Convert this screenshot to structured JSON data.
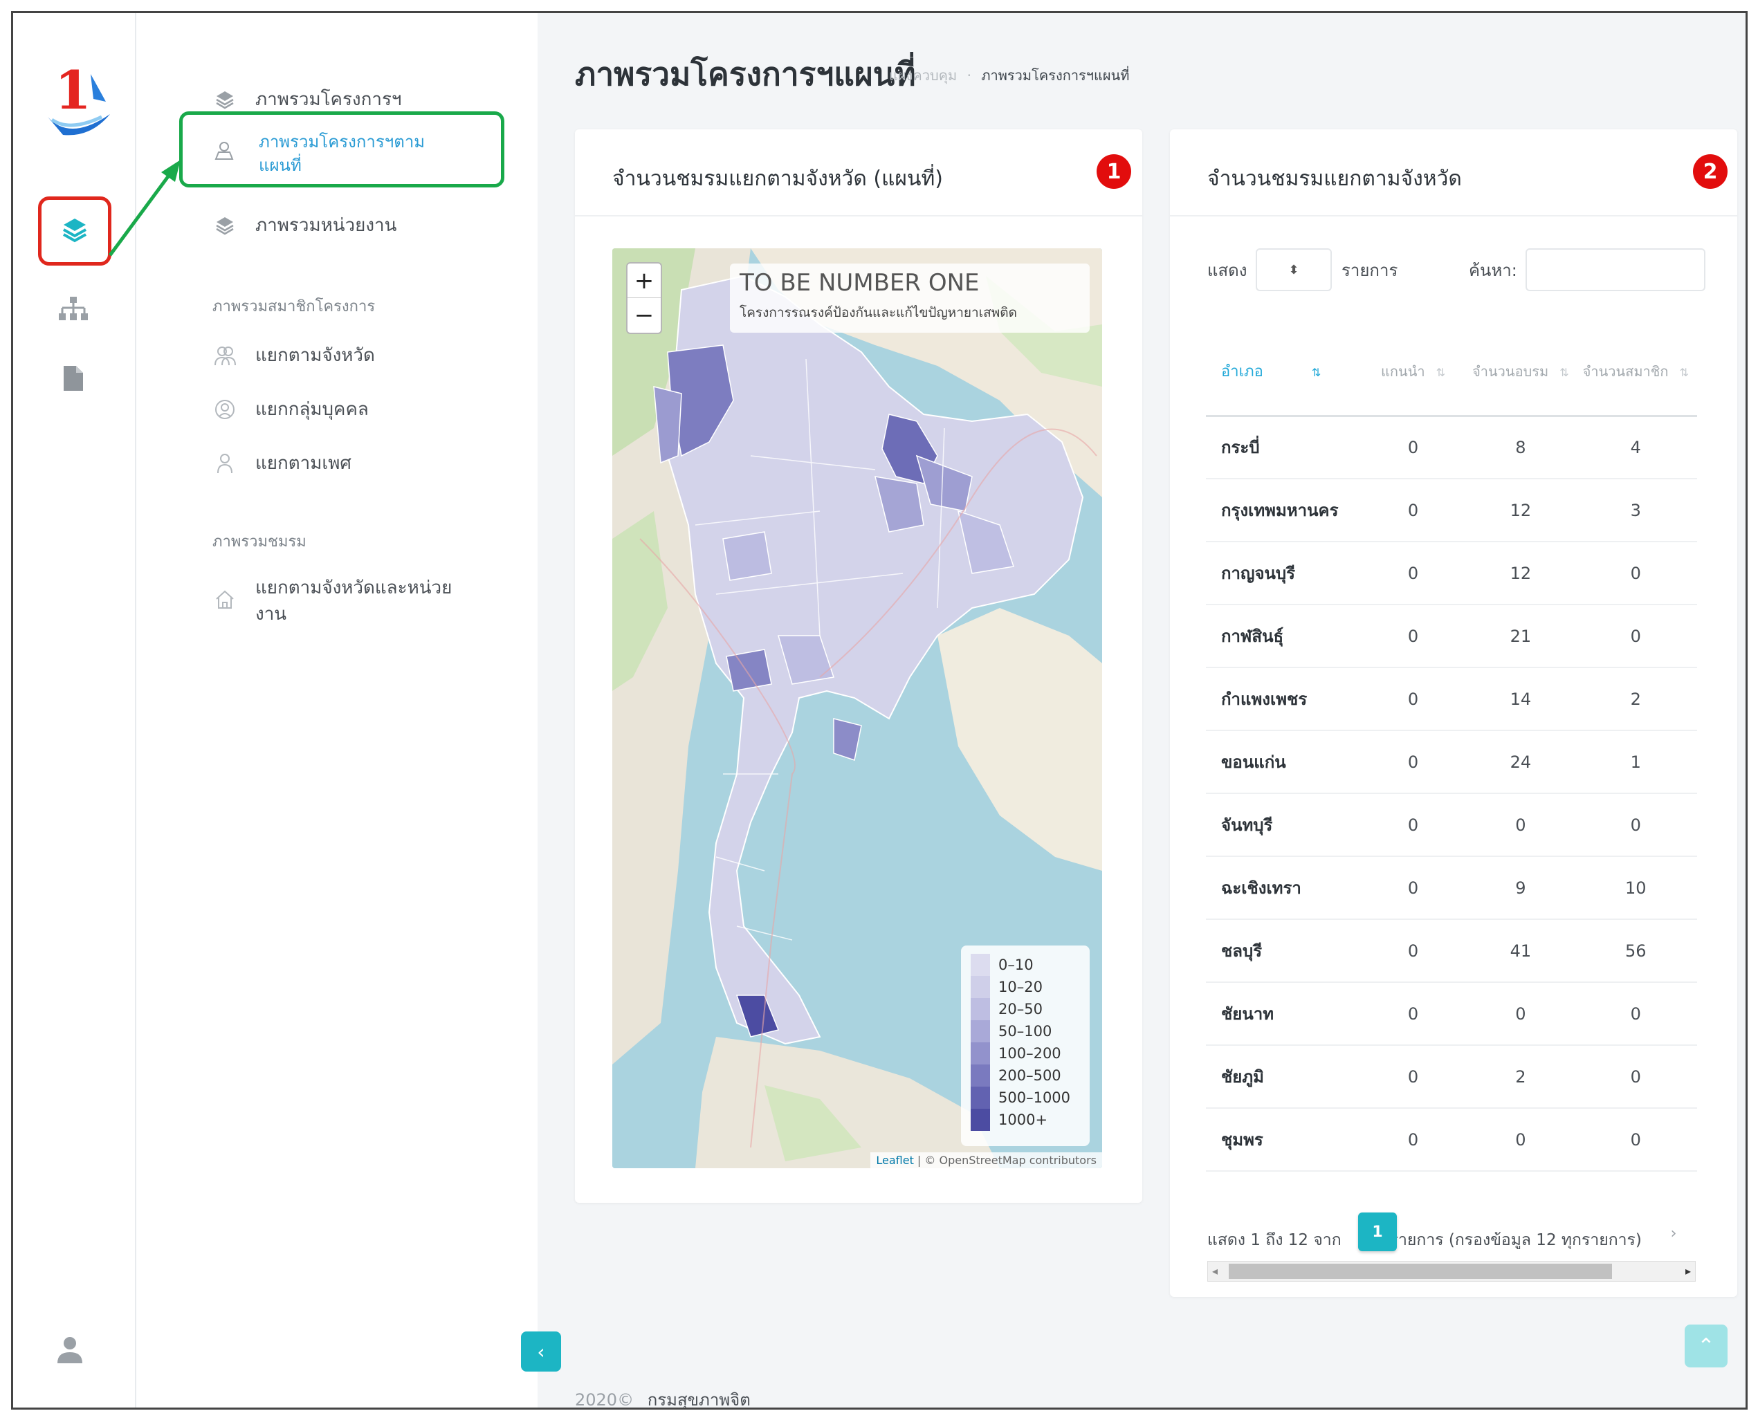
{
  "colors": {
    "accent": "#1cb5c4",
    "active_link": "#2a9bd4",
    "highlight_green": "#19a94a",
    "highlight_red": "#e0271d",
    "badge_red": "#e20d0d"
  },
  "rail": {
    "logo_digit": "1",
    "icons": [
      "layers-icon",
      "sitemap-icon",
      "document-icon",
      "user-icon"
    ]
  },
  "menu": {
    "items": [
      {
        "label": "ภาพรวมโครงการฯ",
        "icon": "layers-icon"
      },
      {
        "label": "ภาพรวมโครงการฯตามแผนที่",
        "icon": "map-user-icon"
      },
      {
        "label": "ภาพรวมหน่วยงาน",
        "icon": "layers-icon"
      }
    ],
    "members_section_title": "ภาพรวมสมาชิกโครงการ",
    "members_items": [
      {
        "label": "แยกตามจังหวัด",
        "icon": "users-icon"
      },
      {
        "label": "แยกกลุ่มบุคคล",
        "icon": "badge-icon"
      },
      {
        "label": "แยกตามเพศ",
        "icon": "person-icon"
      }
    ],
    "clubs_section_title": "ภาพรวมชมรม",
    "clubs_items": [
      {
        "label": "แยกตามจังหวัดและหน่วยงาน",
        "icon": "home-icon"
      }
    ]
  },
  "page": {
    "title": "ภาพรวมโครงการฯแผนที่",
    "breadcrumb_home": "แผงควบคุม",
    "breadcrumb_sep": "·",
    "breadcrumb_current": "ภาพรวมโครงการฯแผนที่"
  },
  "map_card": {
    "title": "จำนวนชมรมแยกตามจังหวัด (แผนที่)",
    "badge": "1",
    "zoom_in": "+",
    "zoom_out": "−",
    "info_title": "TO BE NUMBER ONE",
    "info_subtitle": "โครงการรณรงค์ป้องกันและแก้ไขปัญหายาเสพติด",
    "legend": [
      "0–10",
      "10–20",
      "20–50",
      "50–100",
      "100–200",
      "200–500",
      "500–1000",
      "1000+"
    ],
    "legend_colors": [
      "#dcdcef",
      "#cfcfe9",
      "#bebee2",
      "#a9a9d8",
      "#9292cc",
      "#7a7abf",
      "#6262b1",
      "#4c4ca2"
    ],
    "attribution_leaflet": "Leaflet",
    "attribution_rest": " | © OpenStreetMap contributors"
  },
  "table_card": {
    "title": "จำนวนชมรมแยกตามจังหวัด",
    "badge": "2",
    "show_label": "แสดง",
    "select_value": "",
    "select_arrow": "⬍",
    "rows_label": "รายการ",
    "search_label": "ค้นหา:",
    "columns": [
      "อำเภอ",
      "แกนนำ",
      "จำนวนอบรม",
      "จำนวนสมาชิก"
    ],
    "rows": [
      [
        "กระบี่",
        "0",
        "8",
        "4"
      ],
      [
        "กรุงเทพมหานคร",
        "0",
        "12",
        "3"
      ],
      [
        "กาญจนบุรี",
        "0",
        "12",
        "0"
      ],
      [
        "กาฬสินธุ์",
        "0",
        "21",
        "0"
      ],
      [
        "กำแพงเพชร",
        "0",
        "14",
        "2"
      ],
      [
        "ขอนแก่น",
        "0",
        "24",
        "1"
      ],
      [
        "จันทบุรี",
        "0",
        "0",
        "0"
      ],
      [
        "ฉะเชิงเทรา",
        "0",
        "9",
        "10"
      ],
      [
        "ชลบุรี",
        "0",
        "41",
        "56"
      ],
      [
        "ชัยนาท",
        "0",
        "0",
        "0"
      ],
      [
        "ชัยภูมิ",
        "0",
        "2",
        "0"
      ],
      [
        "ชุมพร",
        "0",
        "0",
        "0"
      ]
    ],
    "info_prefix": "แสดง 1 ถึง 12 จาก",
    "info_suffix": "รายการ (กรองข้อมูล 12 ทุกรายการ)",
    "current_page": "1",
    "next_label": "›"
  },
  "footer": {
    "year": "2020©",
    "org": "กรมสุขภาพจิต"
  },
  "buttons": {
    "collapse": "‹",
    "scroll_top": "⌃"
  }
}
